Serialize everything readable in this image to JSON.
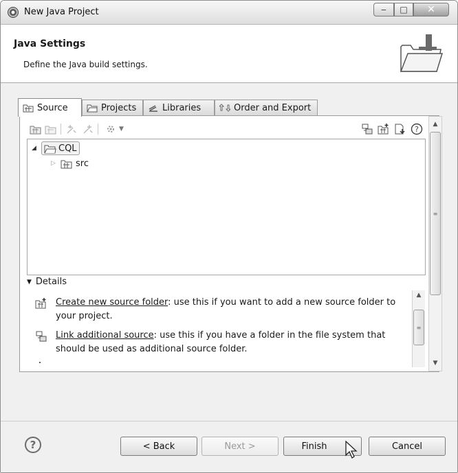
{
  "window": {
    "title": "New Java Project"
  },
  "header": {
    "title": "Java Settings",
    "description": "Define the Java build settings."
  },
  "tabs": [
    {
      "label": "Source",
      "icon": "source-folder-icon",
      "active": true
    },
    {
      "label": "Projects",
      "icon": "projects-folder-icon",
      "active": false
    },
    {
      "label": "Libraries",
      "icon": "libraries-icon",
      "active": false
    },
    {
      "label": "Order and Export",
      "icon": "order-export-icon",
      "active": false
    }
  ],
  "toolbar": {
    "left_icons": [
      "add-source-folder-icon",
      "remove-source-folder-icon",
      "include-icon",
      "exclude-icon",
      "configure-icon"
    ],
    "right_icons": [
      "link-source-icon",
      "create-source-folder-icon",
      "output-folder-icon",
      "help-icon"
    ]
  },
  "tree": {
    "project": {
      "label": "CQL",
      "expanded": true
    },
    "children": [
      {
        "label": "src",
        "expanded": false
      }
    ]
  },
  "details": {
    "heading": "Details",
    "items": [
      {
        "link": "Create new source folder",
        "text": ": use this if you want to add a new source folder to your project.",
        "icon": "create-source-folder-icon"
      },
      {
        "link": "Link additional source",
        "text": ": use this if you have a folder in the file system that should be used as additional source folder.",
        "icon": "link-source-icon"
      }
    ]
  },
  "footer": {
    "help_symbol": "?",
    "back_label": "< Back",
    "next_label": "Next >",
    "finish_label": "Finish",
    "cancel_label": "Cancel"
  }
}
